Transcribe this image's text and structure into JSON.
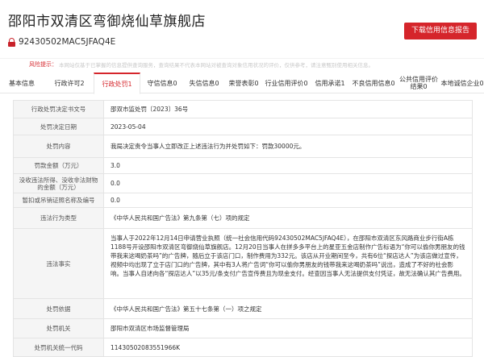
{
  "header": {
    "company_name": "邵阳市双清区弯御烧仙草旗舰店",
    "credit_code": "92430502MAC5JFAQ4E",
    "download_button": "下载信用信息报告"
  },
  "risk_bar": {
    "label": "风险提示：",
    "text": "本网站仅基于已掌握的信息提供查询服务，查询结果不代表本网站对被查询对象信用状况的评价，仅供参考，请注意甄别使用相关信息。"
  },
  "tabs": [
    {
      "label": "基本信息"
    },
    {
      "label": "行政许可2"
    },
    {
      "label": "行政处罚1"
    },
    {
      "label": "守信信息0"
    },
    {
      "label": "失信信息0"
    },
    {
      "label": "荣誉表彰0"
    },
    {
      "label": "行业信用评价0"
    },
    {
      "label": "信用承诺1"
    },
    {
      "label": "不良信用信息0"
    },
    {
      "label": "公共信用评价结果0"
    },
    {
      "label": "本地诚信企业0"
    }
  ],
  "details": {
    "decision_no": {
      "label": "行政处罚决定书文号",
      "value": "邵双市监处罚〔2023〕36号"
    },
    "decision_date": {
      "label": "处罚决定日期",
      "value": "2023-05-04"
    },
    "content": {
      "label": "处罚内容",
      "value": "我局决定责令当事人立即改正上述违法行为并处罚如下：罚款30000元。"
    },
    "fine": {
      "label": "罚款金额（万元）",
      "value": "3.0"
    },
    "confiscated": {
      "label": "没收违法所得、没收非法财物的金额（万元）",
      "value": "0.0"
    },
    "suspended": {
      "label": "暂扣或吊销证照名称及编号",
      "value": "0.0"
    },
    "violation_type": {
      "label": "违法行为类型",
      "value": "《中华人民共和国广告法》第九条第（七）项的规定"
    },
    "facts": {
      "label": "违法事实",
      "value": "当事人于2022年12月14日申请营业执照（统一社会信用代码92430502MAC5JFAQ4E），在邵阳市双清区东风路商业步行街A栋1188号开设邵阳市双清区弯御烧仙草旗舰店。12月20日当事人在拼多多平台上的星亚五金店制作广告标语为“你可以偷你男朋友的钱带我来这喝奶茶吗”的广告牌，随后立于该店门口，制作费用为332元。该店从开业期间至今，共有6位“探店达人”为该店做过宣传，视频中均出现了立于店门口的广告牌，其中有3人将广告词“你可以偷你男朋友的钱带我来这喝奶茶吗”说出，造成了不好的社会影响。当事人自述向各“探店达人”以35元/条支付广告宣传费且为现金支付。经查因当事人无法提供支付凭证，故无法确认其广告费用。"
    },
    "basis": {
      "label": "处罚依据",
      "value": "《中华人民共和国广告法》第五十七条第（一）项之规定"
    },
    "authority": {
      "label": "处罚机关",
      "value": "邵阳市双清区市场监督管理局"
    },
    "authority_code": {
      "label": "处罚机关统一代码",
      "value": "11430502083551966K"
    }
  }
}
